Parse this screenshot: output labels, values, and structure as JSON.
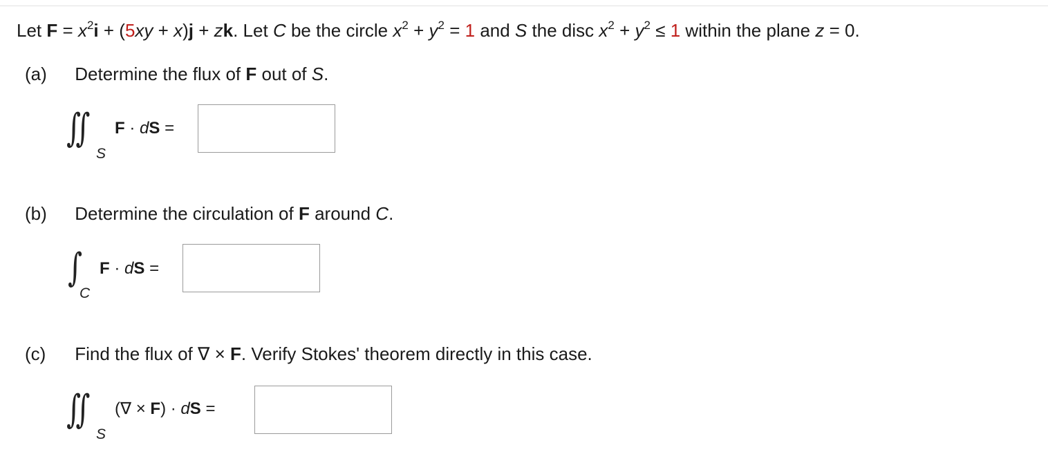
{
  "problem": {
    "let": "Let",
    "F": "F",
    "eq": "=",
    "x": "x",
    "sq1": "2",
    "i": "i",
    "mid": "+ (5",
    "xy": "xy",
    "plusx": "+",
    "x2": "x",
    "close": ")",
    "j": "j",
    "plus2": "+",
    "z": "z",
    "k": "k",
    "letc": ". Let",
    "C": "C",
    "circ": "be the circle",
    "cx": "x",
    "sq2": "2",
    "plus3": "+",
    "cy": "y",
    "sq3": "2",
    "eq2": "=",
    "one": "1",
    "and": "and",
    "S": "S",
    "disc": "the disc",
    "dx": "x",
    "sq4": "2",
    "plus4": "+",
    "dy": "y",
    "sq5": "2",
    "le": "≤",
    "one2": "1",
    "within": "within the plane",
    "pz": "z",
    "eq0": "= 0."
  },
  "parts": {
    "a": {
      "label": "(a)",
      "text1": "Determine the flux of",
      "F": "F",
      "text2": "out of",
      "S": "S",
      "end": "."
    },
    "b": {
      "label": "(b)",
      "text1": "Determine the circulation of",
      "F": "F",
      "text2": "around",
      "C": "C",
      "end": "."
    },
    "c": {
      "label": "(c)",
      "text1": "Find the flux of ∇ ×",
      "F": "F",
      "text2": ". Verify Stokes' theorem directly in this case."
    }
  },
  "integrals": {
    "a": {
      "symbol": "∬",
      "sub": "S",
      "F": "F",
      "dot": "·",
      "d": "d",
      "S": "S",
      "eq": "=",
      "answer": ""
    },
    "b": {
      "symbol": "∫",
      "sub": "C",
      "F": "F",
      "dot": "·",
      "d": "d",
      "S": "S",
      "eq": "=",
      "answer": ""
    },
    "c": {
      "symbol": "∬",
      "sub": "S",
      "open": "(∇ ×",
      "F": "F",
      "close": ")",
      "dot": "·",
      "d": "d",
      "S": "S",
      "eq": "=",
      "answer": ""
    }
  }
}
